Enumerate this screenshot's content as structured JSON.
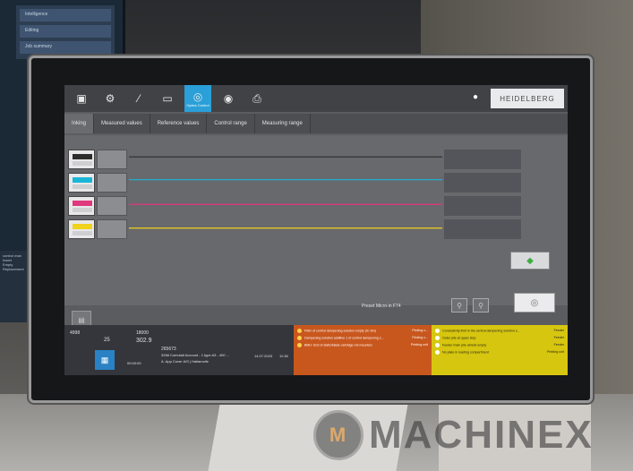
{
  "background": {
    "left_menu": [
      "Intelligence",
      "Editing",
      "Job summary"
    ],
    "left_lower": [
      "control man",
      "Insert",
      "Empty",
      "Replacement"
    ]
  },
  "topbar": {
    "icons": [
      "machine-icon",
      "gear-icon",
      "wand-icon",
      "print-icon",
      "optics-icon",
      "target-icon",
      "printer-icon"
    ],
    "active_label": "Optics Control",
    "brand": "HEIDELBERG"
  },
  "tabs": [
    "Inking",
    "Measured values",
    "Reference values",
    "Control range",
    "Measuring range"
  ],
  "color_rows": [
    {
      "name": "black",
      "color": "#2c2c2c"
    },
    {
      "name": "cyan",
      "color": "#1ab6d8"
    },
    {
      "name": "magenta",
      "color": "#e0387c"
    },
    {
      "name": "yellow",
      "color": "#f1d21c"
    }
  ],
  "chart_data": {
    "type": "line",
    "series": [
      {
        "values": [
          0.9,
          0.9,
          0.9,
          0.9,
          0.9,
          0.9,
          0.9,
          0.9,
          0.9,
          0.9,
          0.9,
          0.9,
          0.9,
          0.9,
          0.9,
          0.9
        ],
        "color": "#2c2c2c"
      },
      {
        "values": [
          0.65,
          0.65,
          0.65,
          0.65,
          0.65,
          0.65,
          0.65,
          0.65,
          0.65,
          0.65,
          0.65,
          0.65,
          0.65,
          0.65,
          0.65,
          0.65
        ],
        "color": "#1ab6d8"
      },
      {
        "values": [
          0.38,
          0.38,
          0.38,
          0.38,
          0.38,
          0.38,
          0.38,
          0.38,
          0.38,
          0.38,
          0.38,
          0.38,
          0.38,
          0.38,
          0.38,
          0.38
        ],
        "color": "#e0387c"
      },
      {
        "values": [
          0.12,
          0.12,
          0.12,
          0.12,
          0.12,
          0.12,
          0.12,
          0.12,
          0.12,
          0.12,
          0.12,
          0.12,
          0.12,
          0.12,
          0.12,
          0.12
        ],
        "color": "#f1d21c"
      }
    ]
  },
  "preset_text": "Preset Micro-in F74",
  "status": {
    "left": {
      "sheets_a": "4998",
      "speed": "25",
      "count": "18000",
      "val2": "302.9",
      "job_no": "265673",
      "job_desc": "3268 Cumulati Account - 1 type A3 - 400 ...",
      "customer": "A. App Cover A/S  |  Hallamolle",
      "date": "14.07.2023",
      "time": "11:36",
      "elapsed": "00:00:00"
    },
    "orange_messages": [
      {
        "text": "Filter of control dampening solution empty (IC-8m)",
        "code": "Finding c..."
      },
      {
        "text": "Dampening solution additive 1 of control dampening s...",
        "code": "Finding c..."
      },
      {
        "text": "BMU: End of static/blade cartridge not mounted",
        "code": "Printing unit"
      }
    ],
    "yellow_messages": [
      {
        "text": "Conductivity limit in the central dampening solution s...",
        "code": "Feeder"
      },
      {
        "text": "Outer pile at upper stop",
        "code": "Feeder"
      },
      {
        "text": "Feeder main pile almost empty",
        "code": "Feeder"
      },
      {
        "text": "No plate in loading compartment",
        "code": "Printing unit"
      }
    ]
  },
  "watermark": "MACHINEX"
}
